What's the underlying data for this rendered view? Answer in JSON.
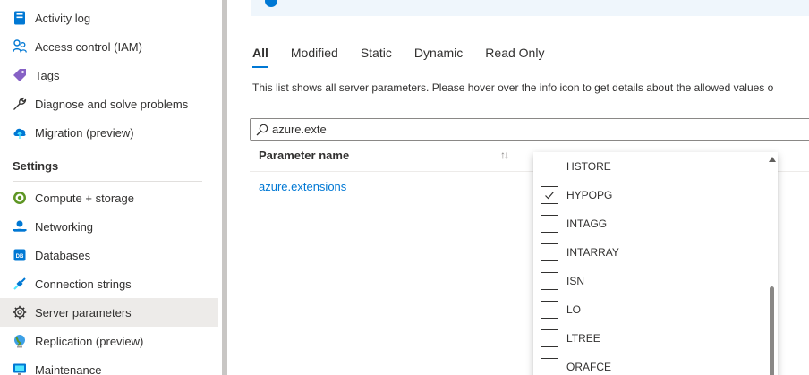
{
  "sidebar": {
    "items": [
      {
        "label": "Activity log",
        "icon": "activity-log-icon"
      },
      {
        "label": "Access control (IAM)",
        "icon": "people-icon"
      },
      {
        "label": "Tags",
        "icon": "tag-icon"
      },
      {
        "label": "Diagnose and solve problems",
        "icon": "wrench-icon"
      },
      {
        "label": "Migration (preview)",
        "icon": "cloud-upload-icon"
      }
    ],
    "settings_header": "Settings",
    "settings_items": [
      {
        "label": "Compute + storage",
        "icon": "compute-icon"
      },
      {
        "label": "Networking",
        "icon": "network-icon"
      },
      {
        "label": "Databases",
        "icon": "database-icon"
      },
      {
        "label": "Connection strings",
        "icon": "connection-icon"
      },
      {
        "label": "Server parameters",
        "icon": "gear-icon",
        "selected": true
      },
      {
        "label": "Replication (preview)",
        "icon": "globe-icon"
      },
      {
        "label": "Maintenance",
        "icon": "monitor-icon"
      }
    ]
  },
  "main": {
    "tabs": [
      {
        "label": "All",
        "active": true
      },
      {
        "label": "Modified"
      },
      {
        "label": "Static"
      },
      {
        "label": "Dynamic"
      },
      {
        "label": "Read Only"
      }
    ],
    "description": "This list shows all server parameters. Please hover over the info icon to get details about the allowed values o",
    "search": {
      "value": "azure.exte",
      "icon": "search-icon"
    },
    "grid": {
      "column_header": "Parameter name",
      "sort_icon": "sort-icon",
      "rows": [
        {
          "name": "azure.extensions"
        }
      ]
    }
  },
  "dropdown": {
    "options": [
      {
        "label": "HSTORE",
        "checked": false
      },
      {
        "label": "HYPOPG",
        "checked": true
      },
      {
        "label": "INTAGG",
        "checked": false
      },
      {
        "label": "INTARRAY",
        "checked": false
      },
      {
        "label": "ISN",
        "checked": false
      },
      {
        "label": "LO",
        "checked": false
      },
      {
        "label": "LTREE",
        "checked": false
      },
      {
        "label": "ORAFCE",
        "checked": false
      }
    ]
  },
  "colors": {
    "accent": "#0078d4",
    "selected_bg": "#edebe9",
    "text": "#323130",
    "divider": "#c8c6c4"
  }
}
